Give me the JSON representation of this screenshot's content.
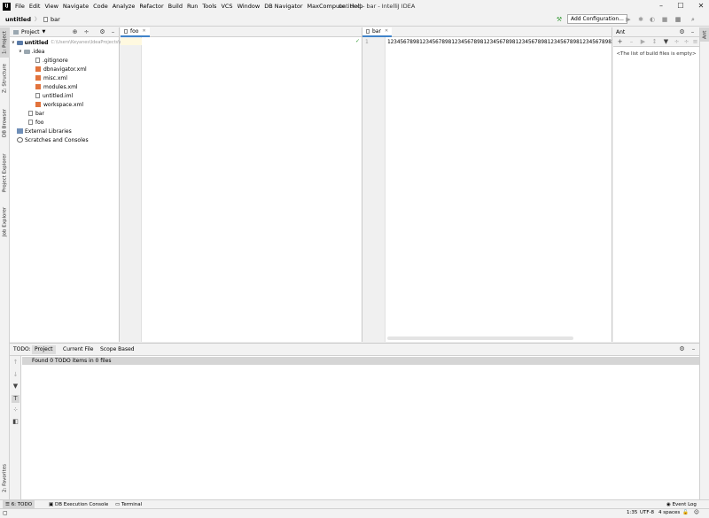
{
  "menu": {
    "logo": "IJ",
    "items": [
      "File",
      "Edit",
      "View",
      "Navigate",
      "Code",
      "Analyze",
      "Refactor",
      "Build",
      "Run",
      "Tools",
      "VCS",
      "Window",
      "DB Navigator",
      "MaxCompute",
      "Help"
    ],
    "window_title": "untitled - bar - IntelliJ IDEA"
  },
  "navbar": {
    "project": "untitled",
    "file": "bar",
    "run_config": "Add Configuration..."
  },
  "left_tools": [
    "1: Project",
    "Z: Structure",
    "DB Browser",
    "Project Explorer",
    "Job Explorer",
    "2: Favorites"
  ],
  "project_panel": {
    "title": "Project",
    "tree": [
      {
        "label": "untitled",
        "path": "C:\\Users\\Keyanes\\IdeaProjects\\untitled",
        "kind": "module"
      },
      {
        "label": ".idea",
        "kind": "folder"
      },
      {
        "label": ".gitignore",
        "kind": "file"
      },
      {
        "label": "dbnavigator.xml",
        "kind": "xml"
      },
      {
        "label": "misc.xml",
        "kind": "xml"
      },
      {
        "label": "modules.xml",
        "kind": "xml"
      },
      {
        "label": "untitled.iml",
        "kind": "file"
      },
      {
        "label": "workspace.xml",
        "kind": "xml"
      },
      {
        "label": "bar",
        "kind": "file"
      },
      {
        "label": "foo",
        "kind": "file"
      },
      {
        "label": "External Libraries",
        "kind": "lib"
      },
      {
        "label": "Scratches and Consoles",
        "kind": "scratch"
      }
    ]
  },
  "editor_left": {
    "tab": "foo"
  },
  "editor_right": {
    "tab": "bar",
    "line_number": "1",
    "code": "12345678981234567898123456789812345678981234567898123456789812345678981234"
  },
  "ant_panel": {
    "title": "Ant",
    "empty_text": "<The list of build files is empty>"
  },
  "todo_panel": {
    "label": "TODO:",
    "tabs": [
      "Project",
      "Current File",
      "Scope Based"
    ],
    "found": "Found 0 TODO items in 0 files"
  },
  "bottom_tabs": [
    "6: TODO",
    "DB Execution Console",
    "Terminal"
  ],
  "status": {
    "event_log": "Event Log",
    "position": "1:35",
    "encoding": "UTF-8",
    "indent": "4 spaces"
  }
}
